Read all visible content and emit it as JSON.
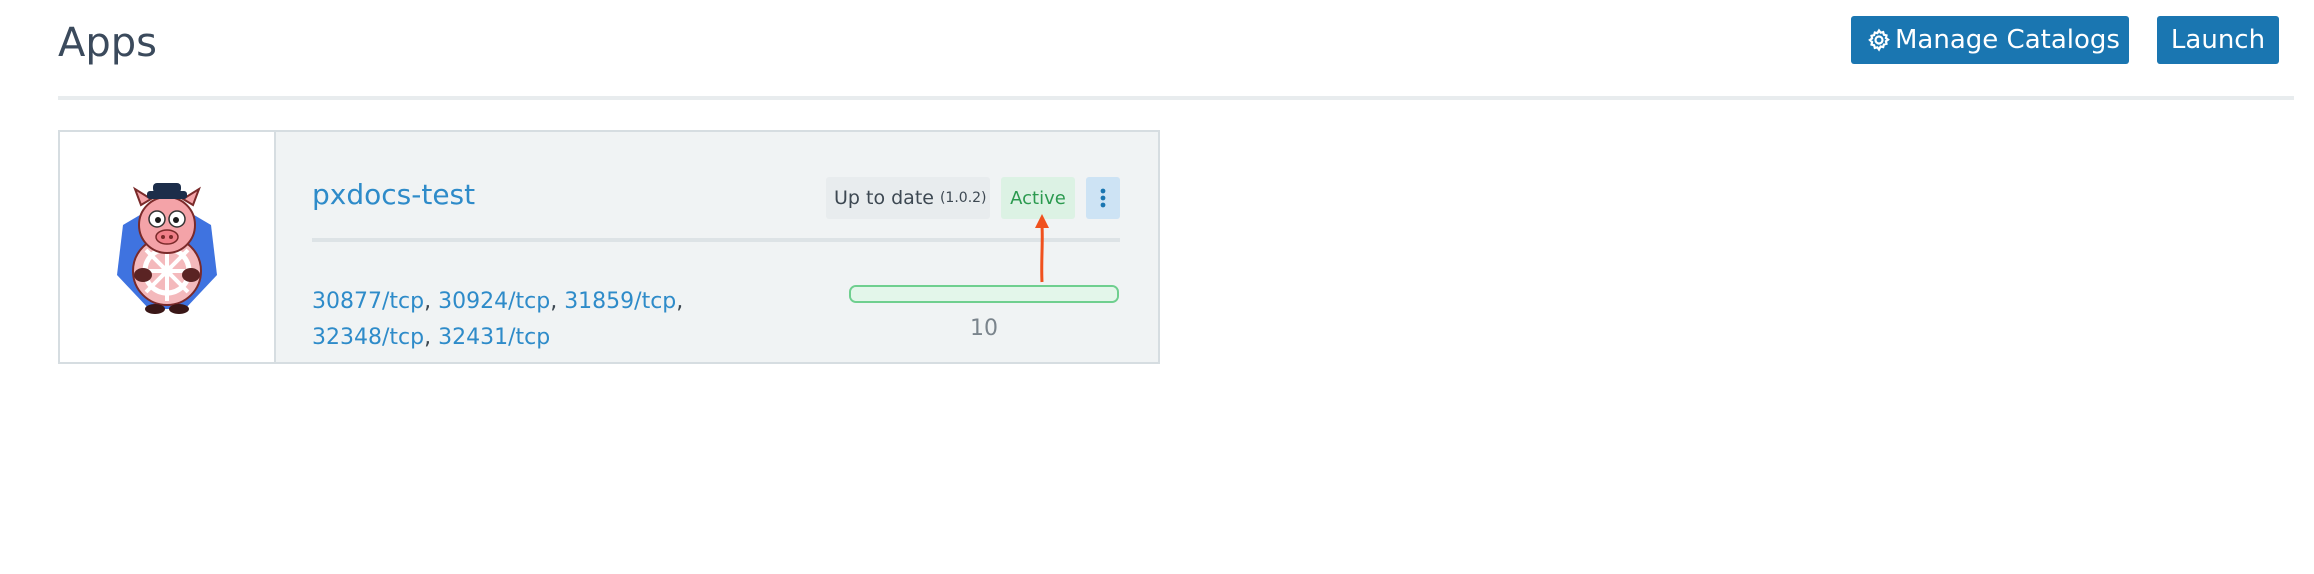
{
  "header": {
    "title": "Apps",
    "manage_catalogs_label": "Manage Catalogs",
    "launch_label": "Launch"
  },
  "app": {
    "name": "pxdocs-test",
    "upgrade_status": "Up to date",
    "version": "(1.0.2)",
    "state": "Active",
    "ports": [
      "30877/tcp",
      "30924/tcp",
      "31859/tcp",
      "32348/tcp",
      "32431/tcp"
    ],
    "progress_value": 1.0,
    "progress_count": "10"
  },
  "colors": {
    "primary": "#1a76b1",
    "link": "#2e8bc9",
    "active_text": "#2b9a4f",
    "active_bg": "#dcf2e4",
    "annotation": "#f0511e"
  },
  "icons": {
    "catalog_button": "gear-icon",
    "menu": "kebab-menu-icon",
    "logo": "kubernetes-pig-logo"
  }
}
